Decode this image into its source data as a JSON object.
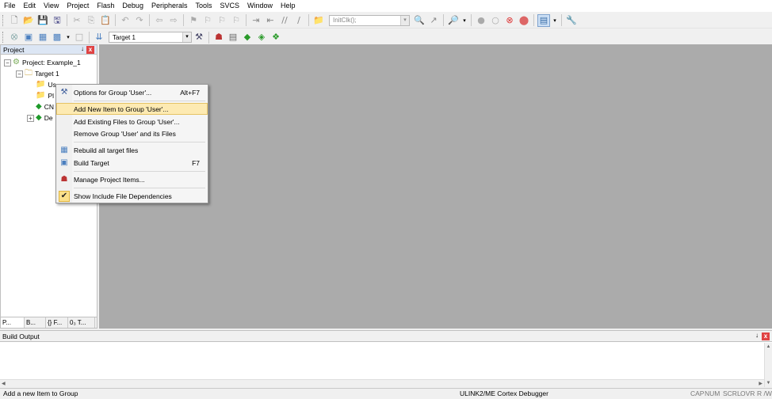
{
  "menubar": [
    "File",
    "Edit",
    "View",
    "Project",
    "Flash",
    "Debug",
    "Peripherals",
    "Tools",
    "SVCS",
    "Window",
    "Help"
  ],
  "toolbar1": {
    "search_value": "InitClk();"
  },
  "toolbar2": {
    "target_value": "Target 1"
  },
  "project_panel": {
    "title": "Project",
    "pin": "↓",
    "close": "x",
    "tree": [
      {
        "label": "Project: Example_1",
        "expander": "−"
      },
      {
        "label": "Target 1",
        "expander": "−"
      },
      {
        "label": "Us"
      },
      {
        "label": "Pl"
      },
      {
        "label": "CN"
      },
      {
        "label": "De",
        "expander": "+"
      }
    ],
    "tabs": [
      "P...",
      "B...",
      "{} F...",
      "0₃ T..."
    ]
  },
  "context_menu": {
    "items": [
      {
        "label": "Options for Group 'User'...",
        "shortcut": "Alt+F7"
      },
      {
        "label": "Add New  Item to Group 'User'...",
        "shortcut": ""
      },
      {
        "label": "Add Existing Files to Group 'User'...",
        "shortcut": ""
      },
      {
        "label": "Remove Group 'User' and its Files",
        "shortcut": ""
      },
      {
        "label": "Rebuild all target files",
        "shortcut": ""
      },
      {
        "label": "Build Target",
        "shortcut": "F7"
      },
      {
        "label": "Manage Project Items...",
        "shortcut": ""
      },
      {
        "label": "Show Include File Dependencies",
        "shortcut": ""
      }
    ]
  },
  "build_output": {
    "title": "Build Output",
    "pin": "↓",
    "close": "x"
  },
  "status": {
    "message": "Add a new Item to Group",
    "debugger": "ULINK2/ME Cortex Debugger",
    "indicators": [
      "CAP",
      "NUM",
      "SCRL",
      "OVR",
      "R /W"
    ]
  },
  "colors": {
    "editor_bg": "#ababab",
    "menu_highlight": "#fdeab2",
    "close_red": "#e04343"
  }
}
